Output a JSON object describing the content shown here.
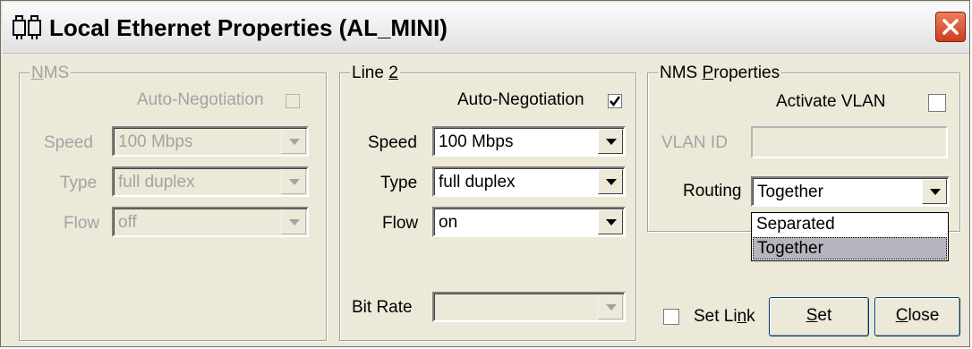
{
  "window": {
    "title": "Local Ethernet Properties (AL_MINI)",
    "app_icon": "ethernet-ports-icon",
    "close_icon": "close-x-icon",
    "close_color": "#d9502f"
  },
  "nms": {
    "legend_pre": "",
    "legend_key": "N",
    "legend_post": "MS",
    "auto_negotiation": "Auto-Negotiation",
    "auto_negotiation_checked": false,
    "speed_label": "Speed",
    "speed_value": "100 Mbps",
    "type_label": "Type",
    "type_value": "full duplex",
    "flow_label": "Flow",
    "flow_value": "off"
  },
  "line2": {
    "legend_pre": "Line ",
    "legend_key": "2",
    "legend_post": "",
    "auto_negotiation": "Auto-Negotiation",
    "auto_negotiation_checked": true,
    "speed_label": "Speed",
    "speed_value": "100 Mbps",
    "type_label": "Type",
    "type_value": "full duplex",
    "flow_label": "Flow",
    "flow_value": "on",
    "bitrate_label": "Bit Rate",
    "bitrate_value": ""
  },
  "nms_properties": {
    "legend_pre": "NMS ",
    "legend_key": "P",
    "legend_post": "roperties",
    "activate_vlan": "Activate VLAN",
    "activate_vlan_checked": false,
    "vlan_id_label": "VLAN ID",
    "vlan_id_value": "",
    "routing_label": "Routing",
    "routing_value": "Together",
    "routing_options": [
      "Separated",
      "Together"
    ],
    "routing_highlighted": "Together"
  },
  "footer": {
    "set_link_pre": "Set Li",
    "set_link_key": "n",
    "set_link_post": "k",
    "set_link_checked": false,
    "set_key": "S",
    "set_rest": "et",
    "close_key": "C",
    "close_rest": "lose"
  }
}
